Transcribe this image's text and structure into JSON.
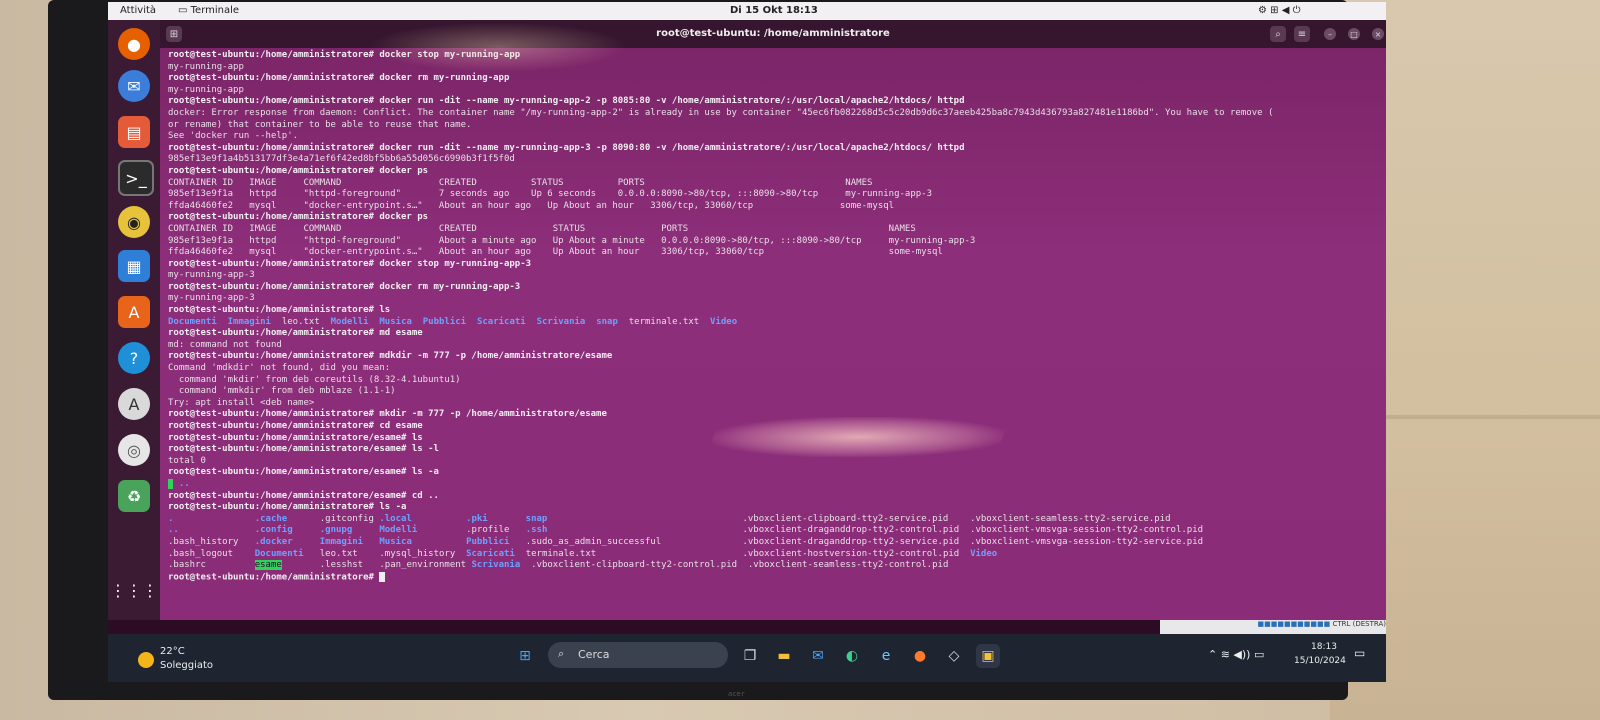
{
  "topbar": {
    "activities": "Attività",
    "app": "Terminale",
    "datetime": "Di 15 Okt 18:13"
  },
  "terminal": {
    "title": "root@test-ubuntu: /home/amministratore",
    "lines": [
      {
        "t": "root@test-ubuntu:/home/amministratore# docker stop my-running-app",
        "c": "prompt"
      },
      {
        "t": "my-running-app",
        "c": ""
      },
      {
        "t": "root@test-ubuntu:/home/amministratore# docker rm my-running-app",
        "c": "prompt"
      },
      {
        "t": "my-running-app",
        "c": ""
      },
      {
        "t": "root@test-ubuntu:/home/amministratore# docker run -dit --name my-running-app-2 -p 8085:80 -v /home/amministratore/:/usr/local/apache2/htdocs/ httpd",
        "c": "prompt"
      },
      {
        "t": "docker: Error response from daemon: Conflict. The container name \"/my-running-app-2\" is already in use by container \"45ec6fb082268d5c5c20db9d6c37aeeb425ba8c7943d436793a827481e1186bd\". You have to remove (",
        "c": ""
      },
      {
        "t": "or rename) that container to be able to reuse that name.",
        "c": ""
      },
      {
        "t": "See 'docker run --help'.",
        "c": ""
      },
      {
        "t": "root@test-ubuntu:/home/amministratore# docker run -dit --name my-running-app-3 -p 8090:80 -v /home/amministratore/:/usr/local/apache2/htdocs/ httpd",
        "c": "prompt"
      },
      {
        "t": "985ef13e9f1a4b513177df3e4a71ef6f42ed8bf5bb6a55d056c6990b3f1f5f0d",
        "c": ""
      },
      {
        "t": "root@test-ubuntu:/home/amministratore# docker ps",
        "c": "prompt"
      },
      {
        "t": "CONTAINER ID   IMAGE     COMMAND                  CREATED          STATUS          PORTS                                     NAMES",
        "c": ""
      },
      {
        "t": "985ef13e9f1a   httpd     \"httpd-foreground\"       7 seconds ago    Up 6 seconds    0.0.0.0:8090->80/tcp, :::8090->80/tcp     my-running-app-3",
        "c": ""
      },
      {
        "t": "ffda46460fe2   mysql     \"docker-entrypoint.s…\"   About an hour ago   Up About an hour   3306/tcp, 33060/tcp                some-mysql",
        "c": ""
      },
      {
        "t": "root@test-ubuntu:/home/amministratore# docker ps",
        "c": "prompt"
      },
      {
        "t": "CONTAINER ID   IMAGE     COMMAND                  CREATED              STATUS              PORTS                                     NAMES",
        "c": ""
      },
      {
        "t": "985ef13e9f1a   httpd     \"httpd-foreground\"       About a minute ago   Up About a minute   0.0.0.0:8090->80/tcp, :::8090->80/tcp     my-running-app-3",
        "c": ""
      },
      {
        "t": "ffda46460fe2   mysql     \"docker-entrypoint.s…\"   About an hour ago    Up About an hour    3306/tcp, 33060/tcp                       some-mysql",
        "c": ""
      },
      {
        "t": "root@test-ubuntu:/home/amministratore# docker stop my-running-app-3",
        "c": "prompt"
      },
      {
        "t": "my-running-app-3",
        "c": ""
      },
      {
        "t": "root@test-ubuntu:/home/amministratore# docker rm my-running-app-3",
        "c": "prompt"
      },
      {
        "t": "my-running-app-3",
        "c": ""
      },
      {
        "t": "root@test-ubuntu:/home/amministratore# ls",
        "c": "prompt"
      },
      {
        "t": "__LS1__",
        "c": "ls1"
      },
      {
        "t": "root@test-ubuntu:/home/amministratore# md esame",
        "c": "prompt"
      },
      {
        "t": "md: command not found",
        "c": ""
      },
      {
        "t": "root@test-ubuntu:/home/amministratore# mdkdir -m 777 -p /home/amministratore/esame",
        "c": "prompt"
      },
      {
        "t": "Command 'mdkdir' not found, did you mean:",
        "c": ""
      },
      {
        "t": "  command 'mkdir' from deb coreutils (8.32-4.1ubuntu1)",
        "c": ""
      },
      {
        "t": "  command 'mmkdir' from deb mblaze (1.1-1)",
        "c": ""
      },
      {
        "t": "Try: apt install <deb name>",
        "c": ""
      },
      {
        "t": "root@test-ubuntu:/home/amministratore# mkdir -m 777 -p /home/amministratore/esame",
        "c": "prompt"
      },
      {
        "t": "root@test-ubuntu:/home/amministratore# cd esame",
        "c": "prompt"
      },
      {
        "t": "root@test-ubuntu:/home/amministratore/esame# ls",
        "c": "prompt"
      },
      {
        "t": "root@test-ubuntu:/home/amministratore/esame# ls -l",
        "c": "prompt"
      },
      {
        "t": "total 0",
        "c": ""
      },
      {
        "t": "root@test-ubuntu:/home/amministratore/esame# ls -a",
        "c": "prompt"
      },
      {
        "t": "__DOTS__",
        "c": "dots"
      },
      {
        "t": "root@test-ubuntu:/home/amministratore/esame# cd ..",
        "c": "prompt"
      },
      {
        "t": "root@test-ubuntu:/home/amministratore# ls -a",
        "c": "prompt"
      }
    ],
    "ls_items": [
      {
        "t": "Documenti",
        "b": true
      },
      {
        "t": "Immagini",
        "b": true
      },
      {
        "t": "leo.txt",
        "b": false
      },
      {
        "t": "Modelli",
        "b": true
      },
      {
        "t": "Musica",
        "b": true
      },
      {
        "t": "Pubblici",
        "b": true
      },
      {
        "t": "Scaricati",
        "b": true
      },
      {
        "t": "Scrivania",
        "b": true
      },
      {
        "t": "snap",
        "b": true
      },
      {
        "t": "terminale.txt",
        "b": false
      },
      {
        "t": "Video",
        "b": true
      }
    ],
    "dots": [
      "..",
      ".."
    ],
    "lsa_rows": [
      [
        {
          "t": ".",
          "b": true
        },
        {
          "t": ".cache",
          "b": true
        },
        {
          "t": ".gitconfig",
          "b": false
        },
        {
          "t": ".local",
          "b": true
        },
        {
          "t": ".pki",
          "b": true
        },
        {
          "t": "snap",
          "b": true
        },
        {
          "t": ".vboxclient-clipboard-tty2-service.pid",
          "b": false
        },
        {
          "t": ".vboxclient-seamless-tty2-service.pid",
          "b": false
        }
      ],
      [
        {
          "t": "..",
          "b": true
        },
        {
          "t": ".config",
          "b": true
        },
        {
          "t": ".gnupg",
          "b": true
        },
        {
          "t": "Modelli",
          "b": true
        },
        {
          "t": ".profile",
          "b": false
        },
        {
          "t": ".ssh",
          "b": true
        },
        {
          "t": ".vboxclient-draganddrop-tty2-control.pid",
          "b": false
        },
        {
          "t": ".vboxclient-vmsvga-session-tty2-control.pid",
          "b": false
        }
      ],
      [
        {
          "t": ".bash_history",
          "b": false
        },
        {
          "t": ".docker",
          "b": true
        },
        {
          "t": "Immagini",
          "b": true
        },
        {
          "t": "Musica",
          "b": true
        },
        {
          "t": "Pubblici",
          "b": true
        },
        {
          "t": ".sudo_as_admin_successful",
          "b": false
        },
        {
          "t": ".vboxclient-draganddrop-tty2-service.pid",
          "b": false
        },
        {
          "t": ".vboxclient-vmsvga-session-tty2-service.pid",
          "b": false
        }
      ],
      [
        {
          "t": ".bash_logout",
          "b": false
        },
        {
          "t": "Documenti",
          "b": true
        },
        {
          "t": "leo.txt",
          "b": false
        },
        {
          "t": ".mysql_history",
          "b": false
        },
        {
          "t": "Scaricati",
          "b": true
        },
        {
          "t": "terminale.txt",
          "b": false
        },
        {
          "t": ".vboxclient-hostversion-tty2-control.pid",
          "b": false
        },
        {
          "t": "Video",
          "b": true
        }
      ],
      [
        {
          "t": ".bashrc",
          "b": false
        },
        {
          "t": "esame",
          "b": false,
          "hl": true
        },
        {
          "t": ".lesshst",
          "b": false
        },
        {
          "t": ".pan_environment",
          "b": false
        },
        {
          "t": "Scrivania",
          "b": true
        },
        {
          "t": ".vboxclient-clipboard-tty2-control.pid",
          "b": false
        },
        {
          "t": ".vboxclient-seamless-tty2-control.pid",
          "b": false
        },
        {
          "t": "",
          "b": false
        }
      ]
    ],
    "final_prompt": "root@test-ubuntu:/home/amministratore#"
  },
  "vbox": {
    "hostkey": "CTRL (DESTRA)"
  },
  "taskbar": {
    "temp": "22°C",
    "weather": "Soleggiato",
    "search_placeholder": "Cerca",
    "time": "18:13",
    "date": "15/10/2024"
  },
  "monitor": {
    "brand": "acer"
  }
}
